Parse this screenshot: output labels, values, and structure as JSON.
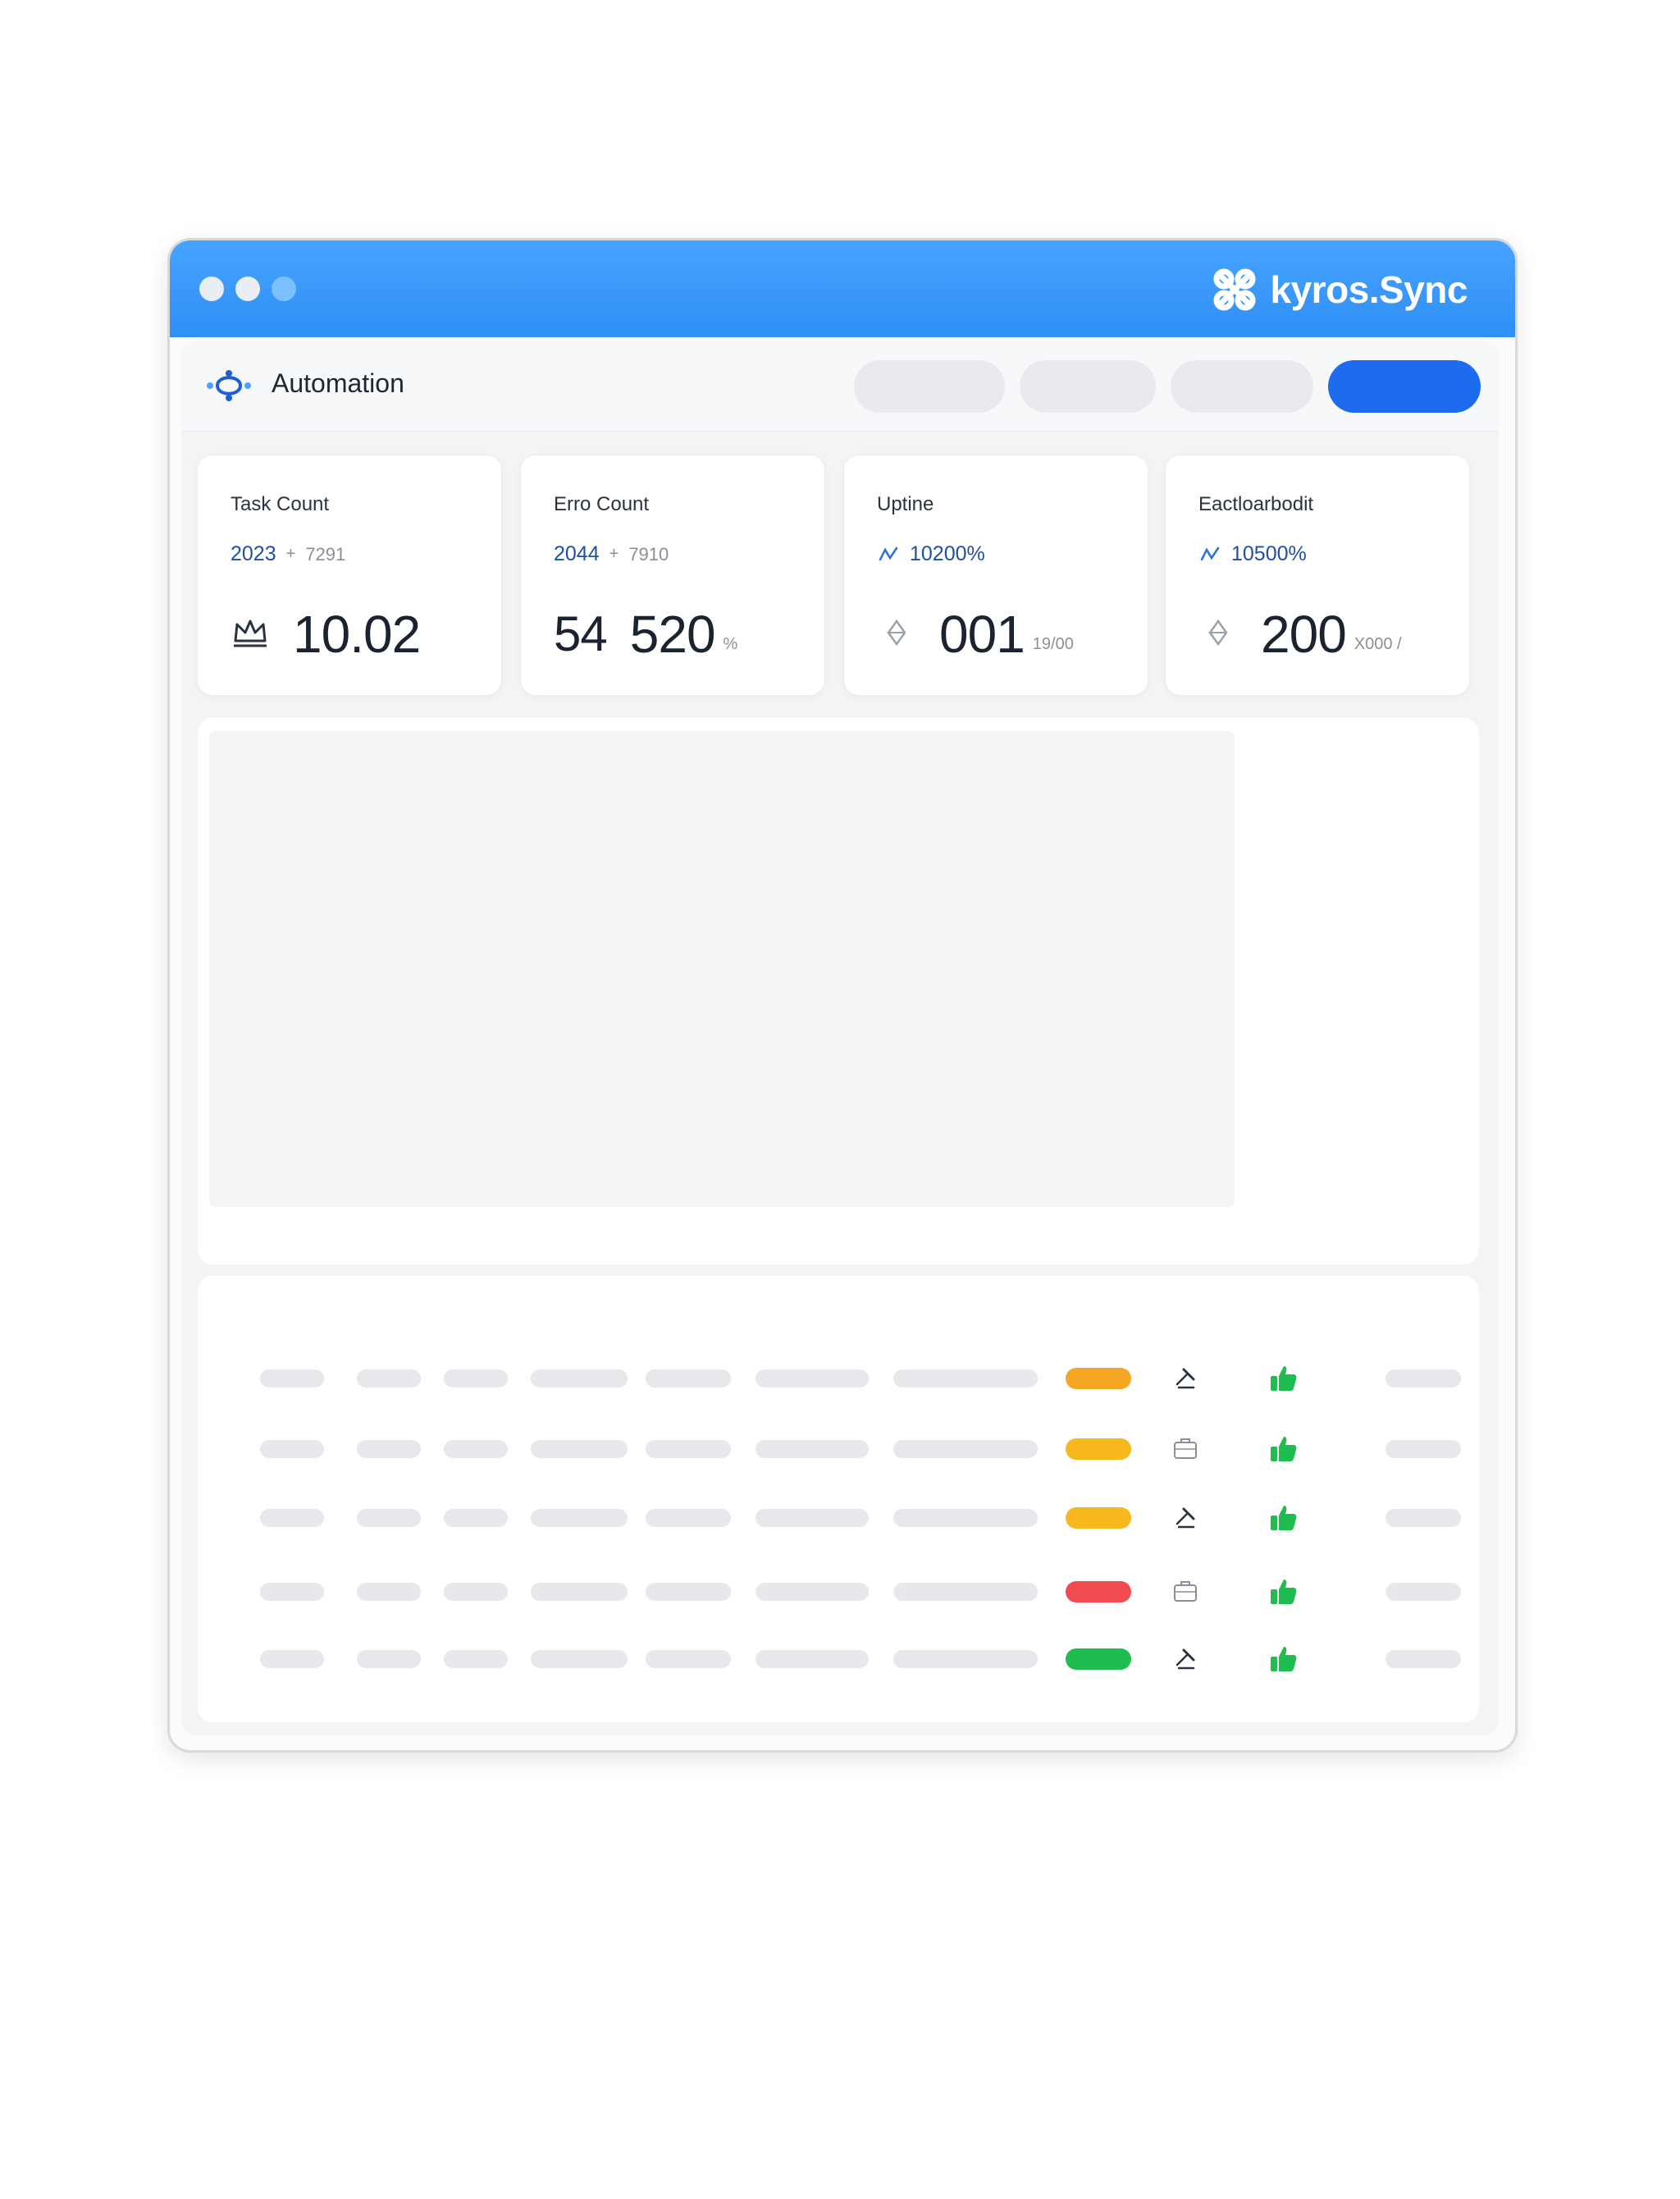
{
  "window": {
    "brand_name": "kyros.Sync",
    "brand_icon": "kyros-logo-icon",
    "accent_color": "#2f8ff5"
  },
  "toolbar": {
    "app_title": "Automation",
    "app_icon": "automation-logo-icon",
    "primary_button_color": "#1d6cf0"
  },
  "stats": [
    {
      "title": "Task Count",
      "sub_value": "2023",
      "sub_plus": "+",
      "sub_muted": "7291",
      "main_value": "10.02",
      "main_unit": "",
      "icon": "crown-icon"
    },
    {
      "title": "Erro Count",
      "sub_value": "2044",
      "sub_plus": "+",
      "sub_muted": "7910",
      "main_prefix": "54",
      "main_value": "520",
      "main_unit": "%"
    },
    {
      "title": "Uptine",
      "sub_value": "10200%",
      "sub_icon": "trend-icon",
      "main_value": "001",
      "main_unit": "19/00",
      "icon": "diamond-icon"
    },
    {
      "title": "Eactloarbodit",
      "sub_value": "10500%",
      "sub_icon": "trend-icon",
      "main_value": "200",
      "main_unit": "X000 /",
      "icon": "diamond-icon"
    }
  ],
  "table": {
    "rows": [
      {
        "status": "orange",
        "action_icon": "gavel-icon",
        "like_icon": "thumbs-up-icon"
      },
      {
        "status": "yellow",
        "action_icon": "briefcase-icon",
        "like_icon": "thumbs-up-icon"
      },
      {
        "status": "yellow",
        "action_icon": "gavel-icon",
        "like_icon": "thumbs-up-icon"
      },
      {
        "status": "red",
        "action_icon": "briefcase-icon",
        "like_icon": "thumbs-up-icon"
      },
      {
        "status": "green",
        "action_icon": "gavel-icon",
        "like_icon": "thumbs-up-icon"
      }
    ],
    "status_colors": {
      "orange": "#f5a623",
      "yellow": "#f7b81e",
      "red": "#ef4b50",
      "green": "#1fbd4f"
    }
  }
}
